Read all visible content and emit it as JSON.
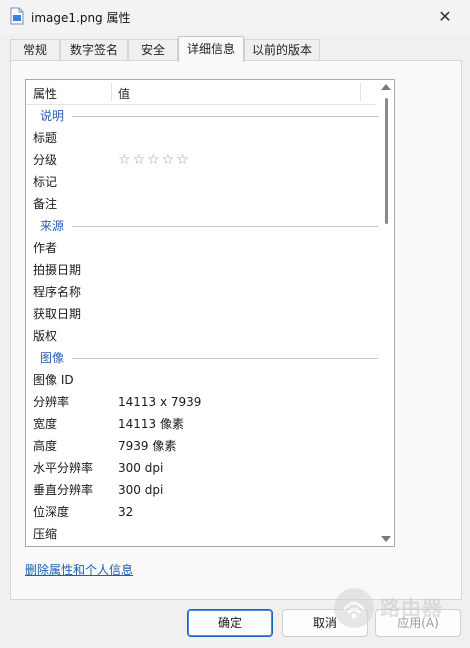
{
  "window": {
    "title": "image1.png 属性",
    "close_symbol": "✕"
  },
  "tabs": [
    {
      "label": "常规"
    },
    {
      "label": "数字签名"
    },
    {
      "label": "安全"
    },
    {
      "label": "详细信息",
      "active": true
    },
    {
      "label": "以前的版本"
    }
  ],
  "columns": {
    "property": "属性",
    "value": "值"
  },
  "groups": {
    "description": "说明",
    "origin": "来源",
    "image": "图像"
  },
  "rows": {
    "title": {
      "p": "标题",
      "v": ""
    },
    "rating": {
      "p": "分级",
      "stars": "☆☆☆☆☆",
      "rating_value": 0,
      "rating_max": 5
    },
    "tags": {
      "p": "标记",
      "v": ""
    },
    "comments": {
      "p": "备注",
      "v": ""
    },
    "author": {
      "p": "作者",
      "v": ""
    },
    "date_taken": {
      "p": "拍摄日期",
      "v": ""
    },
    "program": {
      "p": "程序名称",
      "v": ""
    },
    "date_acquired": {
      "p": "获取日期",
      "v": ""
    },
    "copyright": {
      "p": "版权",
      "v": ""
    },
    "image_id": {
      "p": "图像 ID",
      "v": ""
    },
    "dimensions": {
      "p": "分辨率",
      "v": "14113 x 7939"
    },
    "width": {
      "p": "宽度",
      "v": "14113 像素"
    },
    "height": {
      "p": "高度",
      "v": "7939 像素"
    },
    "h_res": {
      "p": "水平分辨率",
      "v": "300 dpi"
    },
    "v_res": {
      "p": "垂直分辨率",
      "v": "300 dpi"
    },
    "bit_depth": {
      "p": "位深度",
      "v": "32"
    },
    "compression": {
      "p": "压缩",
      "v": ""
    }
  },
  "links": {
    "remove_props": "删除属性和个人信息"
  },
  "buttons": {
    "ok": "确定",
    "cancel": "取消",
    "apply": "应用(A)"
  },
  "watermark": {
    "text": "路由器"
  }
}
